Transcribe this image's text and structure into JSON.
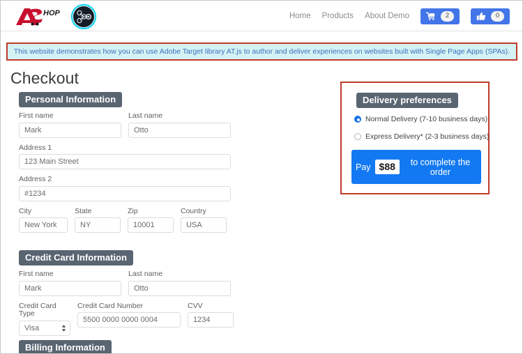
{
  "header": {
    "brand_name": "ASHOP",
    "brand_suffix": "HOP",
    "target_icon": "adobe-target-node-graph-icon",
    "nav_links": [
      {
        "label": "Home"
      },
      {
        "label": "Products"
      },
      {
        "label": "About Demo"
      }
    ],
    "cart_button": {
      "icon": "shopping-cart-icon",
      "count": "2"
    },
    "like_button": {
      "icon": "thumbs-up-icon",
      "count": "0"
    }
  },
  "notice": {
    "text": "This website demonstrates how you can use Adobe Target library AT.js to author and deliver experiences on websites built with Single Page Apps (SPAs).",
    "background_color": "#d4f2f4",
    "border_color": "#c0392b",
    "text_color": "#3b6fbf"
  },
  "page": {
    "title": "Checkout"
  },
  "personal_information": {
    "heading": "Personal Information",
    "first_name": {
      "label": "First name",
      "value": "Mark"
    },
    "last_name": {
      "label": "Last name",
      "value": "Otto"
    },
    "address1": {
      "label": "Address 1",
      "value": "123 Main Street"
    },
    "address2": {
      "label": "Address 2",
      "value": "#1234"
    },
    "city": {
      "label": "City",
      "value": "New York"
    },
    "state": {
      "label": "State",
      "value": "NY"
    },
    "zip": {
      "label": "Zip",
      "value": "10001"
    },
    "country": {
      "label": "Country",
      "value": "USA"
    }
  },
  "credit_card_information": {
    "heading": "Credit Card Information",
    "first_name": {
      "label": "First name",
      "value": "Mark"
    },
    "last_name": {
      "label": "Last name",
      "value": "Otto"
    },
    "card_type": {
      "label": "Credit Card Type",
      "value": "Visa"
    },
    "card_number": {
      "label": "Credit Card Number",
      "value": "5500 0000 0000 0004"
    },
    "cvv": {
      "label": "CVV",
      "value": "1234"
    }
  },
  "billing_information": {
    "heading": "Billing Information"
  },
  "delivery_preferences": {
    "heading": "Delivery preferences",
    "highlight_border_color": "#c0392b",
    "options": [
      {
        "label": "Normal Delivery (7-10 business days)",
        "selected": true
      },
      {
        "label": "Express Delivery* (2-3 business days)",
        "selected": false
      }
    ],
    "pay_button": {
      "prefix": "Pay",
      "amount": "$88",
      "suffix": "to complete the order",
      "color": "#1379f2"
    }
  }
}
